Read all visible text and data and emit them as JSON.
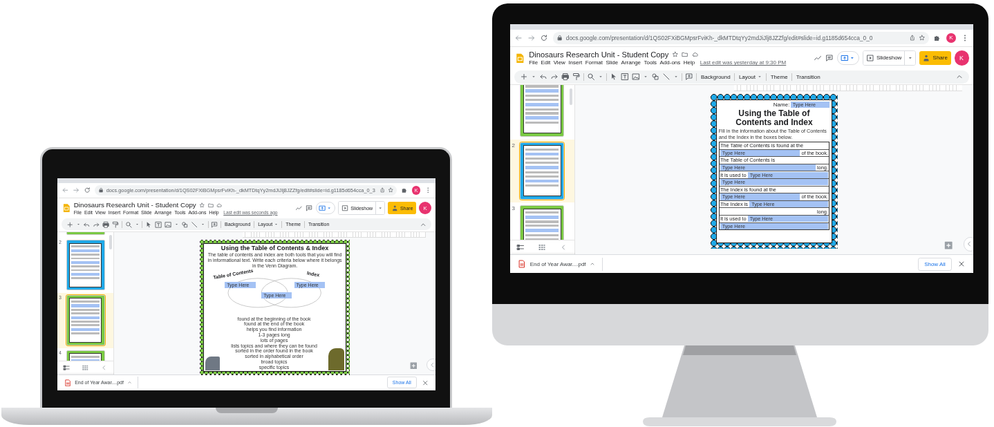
{
  "devices": [
    {
      "kind": "laptop",
      "screen": {
        "url": "docs.google.com/presentation/d/1QS02FXiBGMpsrFviKh-_dkMTDtqYy2mdJiJlj8JZZfg/edit#slide=id.g1185d654cca_0_3",
        "browser_avatar": "K",
        "doc_title": "Dinosaurs Research Unit - Student Copy",
        "menus": [
          "File",
          "Edit",
          "View",
          "Insert",
          "Format",
          "Slide",
          "Arrange",
          "Tools",
          "Add-ons",
          "Help"
        ],
        "last_edit": "Last edit was seconds ago",
        "slideshow": "Slideshow",
        "share": "Share",
        "user_avatar": "K",
        "toolbar": [
          {
            "label": "Background",
            "dropdown": false
          },
          {
            "label": "Layout",
            "dropdown": true
          },
          {
            "label": "Theme",
            "dropdown": false
          },
          {
            "label": "Transition",
            "dropdown": false
          }
        ],
        "thumbnails": [
          {
            "color": "#7ac943",
            "selected": false
          },
          {
            "number": "2",
            "color": "#1fa9e8",
            "selected": false
          },
          {
            "number": "3",
            "color": "#7ac943",
            "selected": true
          },
          {
            "number": "4",
            "color": "#7ac943",
            "selected": false
          }
        ],
        "slide": {
          "kind": "venn",
          "title": "Using the Table of Contents & Index",
          "intro": "The table of contents and index are both tools that you will find in informational text. Write each criteria below where it belongs in the Venn Diagram.",
          "left_label": "Table of Contents",
          "right_label": "Index",
          "fields": [
            "Type Here",
            "Type Here",
            "Type Here"
          ],
          "criteria": [
            "found at the beginning of the book",
            "found at the end of the book",
            "helps you find information",
            "1-3 pages long",
            "lots of pages",
            "lists topics and where they can be found",
            "sorted in the order found in the book",
            "sorted in alphabetical order",
            "broad topics",
            "specific topics"
          ]
        },
        "download": {
          "file": "End of Year Awar....pdf",
          "show_all": "Show All"
        }
      }
    },
    {
      "kind": "monitor",
      "screen": {
        "url": "docs.google.com/presentation/d/1QS02FXiBGMpsrFviKh-_dkMTDtqYy2mdJiJlj8JZZfg/edit#slide=id.g1185d654cca_0_0",
        "browser_avatar": "K",
        "doc_title": "Dinosaurs Research Unit - Student Copy",
        "menus": [
          "File",
          "Edit",
          "View",
          "Insert",
          "Format",
          "Slide",
          "Arrange",
          "Tools",
          "Add-ons",
          "Help"
        ],
        "last_edit": "Last edit was yesterday at 9:30 PM",
        "slideshow": "Slideshow",
        "share": "Share",
        "user_avatar": "K",
        "toolbar": [
          {
            "label": "Background",
            "dropdown": false
          },
          {
            "label": "Layout",
            "dropdown": true
          },
          {
            "label": "Theme",
            "dropdown": false
          },
          {
            "label": "Transition",
            "dropdown": false
          }
        ],
        "thumbnails": [
          {
            "color": "#7ac943",
            "selected": false
          },
          {
            "number": "2",
            "color": "#1fa9e8",
            "selected": true
          },
          {
            "number": "3",
            "color": "#7ac943",
            "selected": false
          }
        ],
        "slide": {
          "kind": "worksheet",
          "name_label": "Name:",
          "name_field": "Type Here",
          "title": "Using the Table of Contents and Index",
          "intro": "Fill in the information about the Table of Contents and the Index in the boxes below.",
          "lines": [
            [
              {
                "kind": "text",
                "text": "The Table of Contents is found at the"
              }
            ],
            [
              {
                "kind": "field",
                "text": "Type Here"
              },
              {
                "kind": "text",
                "text": "of the book."
              }
            ],
            [
              {
                "kind": "text",
                "text": "The Table of Contents is"
              }
            ],
            [
              {
                "kind": "field",
                "text": "Type Here"
              },
              {
                "kind": "text",
                "text": "long."
              }
            ],
            [
              {
                "kind": "text",
                "text": "It is used to"
              },
              {
                "kind": "field",
                "text": "Type Here"
              }
            ],
            [
              {
                "kind": "field",
                "text": "Type Here"
              }
            ],
            [
              {
                "kind": "text",
                "text": "The Index is found at the"
              }
            ],
            [
              {
                "kind": "field",
                "text": "Type Here"
              },
              {
                "kind": "text",
                "text": "of the book."
              }
            ],
            [
              {
                "kind": "text",
                "text": "The Index is"
              },
              {
                "kind": "field",
                "text": "Type Here"
              }
            ],
            [
              {
                "kind": "gap"
              },
              {
                "kind": "text",
                "text": "long."
              }
            ],
            [
              {
                "kind": "text",
                "text": "It is used to"
              },
              {
                "kind": "field",
                "text": "Type Here"
              }
            ],
            [
              {
                "kind": "field",
                "text": "Type Here"
              }
            ]
          ]
        },
        "download": {
          "file": "End of Year Awar....pdf",
          "show_all": "Show All"
        }
      }
    }
  ]
}
